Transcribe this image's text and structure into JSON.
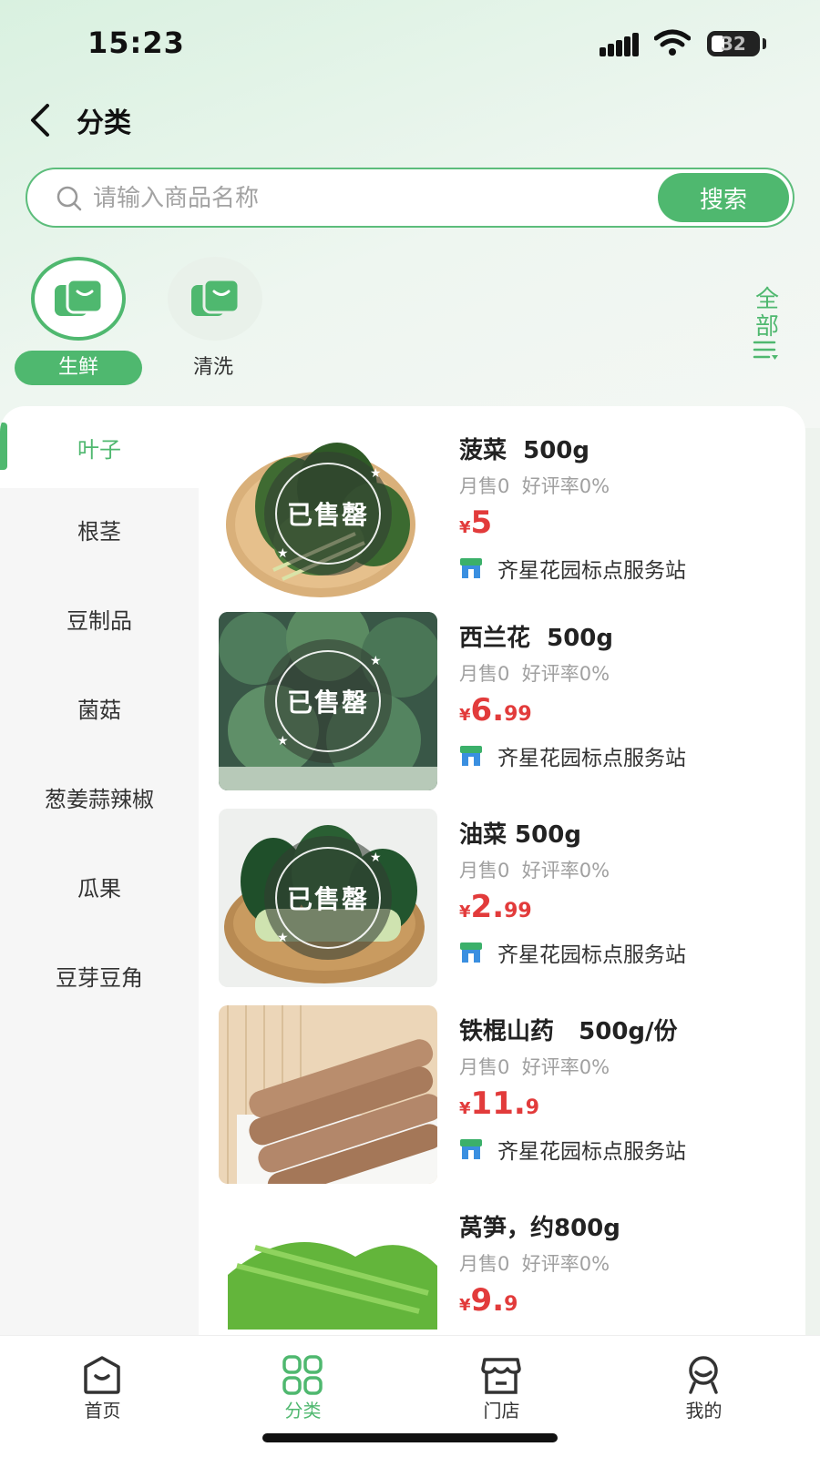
{
  "status_bar": {
    "time": "15:23",
    "battery": "32"
  },
  "header": {
    "title": "分类"
  },
  "search": {
    "placeholder": "请输入商品名称",
    "button_label": "搜索"
  },
  "categories": [
    {
      "label": "生鲜",
      "active": true,
      "icon": "shop-bag-icon"
    },
    {
      "label": "清洗",
      "active": false,
      "icon": "shop-bag-icon"
    }
  ],
  "all_button": {
    "label": "全部"
  },
  "sidebar": {
    "items": [
      {
        "label": "叶子",
        "active": true
      },
      {
        "label": "根茎"
      },
      {
        "label": "豆制品"
      },
      {
        "label": "菌菇"
      },
      {
        "label": "葱姜蒜辣椒"
      },
      {
        "label": "瓜果"
      },
      {
        "label": "豆芽豆角"
      }
    ]
  },
  "products": [
    {
      "name": "菠菜  500g",
      "stats": "月售0  好评率0%",
      "currency": "¥",
      "price_int": "5",
      "price_dec": "",
      "store": "齐星花园标点服务站",
      "sold_out": "已售罄"
    },
    {
      "name": "西兰花  500g",
      "stats": "月售0  好评率0%",
      "currency": "¥",
      "price_int": "6.",
      "price_dec": "99",
      "store": "齐星花园标点服务站",
      "sold_out": "已售罄"
    },
    {
      "name": "油菜 500g",
      "stats": "月售0  好评率0%",
      "currency": "¥",
      "price_int": "2.",
      "price_dec": "99",
      "store": "齐星花园标点服务站",
      "sold_out": "已售罄"
    },
    {
      "name": "铁棍山药   500g/份",
      "stats": "月售0  好评率0%",
      "currency": "¥",
      "price_int": "11.",
      "price_dec": "9",
      "store": "齐星花园标点服务站",
      "sold_out": ""
    },
    {
      "name": "莴笋，约800g",
      "stats": "月售0  好评率0%",
      "currency": "¥",
      "price_int": "9.",
      "price_dec": "9",
      "store": "",
      "sold_out": ""
    }
  ],
  "bottom_nav": {
    "items": [
      {
        "label": "首页",
        "icon": "home-icon"
      },
      {
        "label": "分类",
        "icon": "category-grid-icon",
        "active": true
      },
      {
        "label": "门店",
        "icon": "store-icon"
      },
      {
        "label": "我的",
        "icon": "profile-icon"
      }
    ]
  },
  "colors": {
    "accent": "#4fb86f",
    "price": "#e23b3b",
    "muted": "#a0a0a0"
  }
}
